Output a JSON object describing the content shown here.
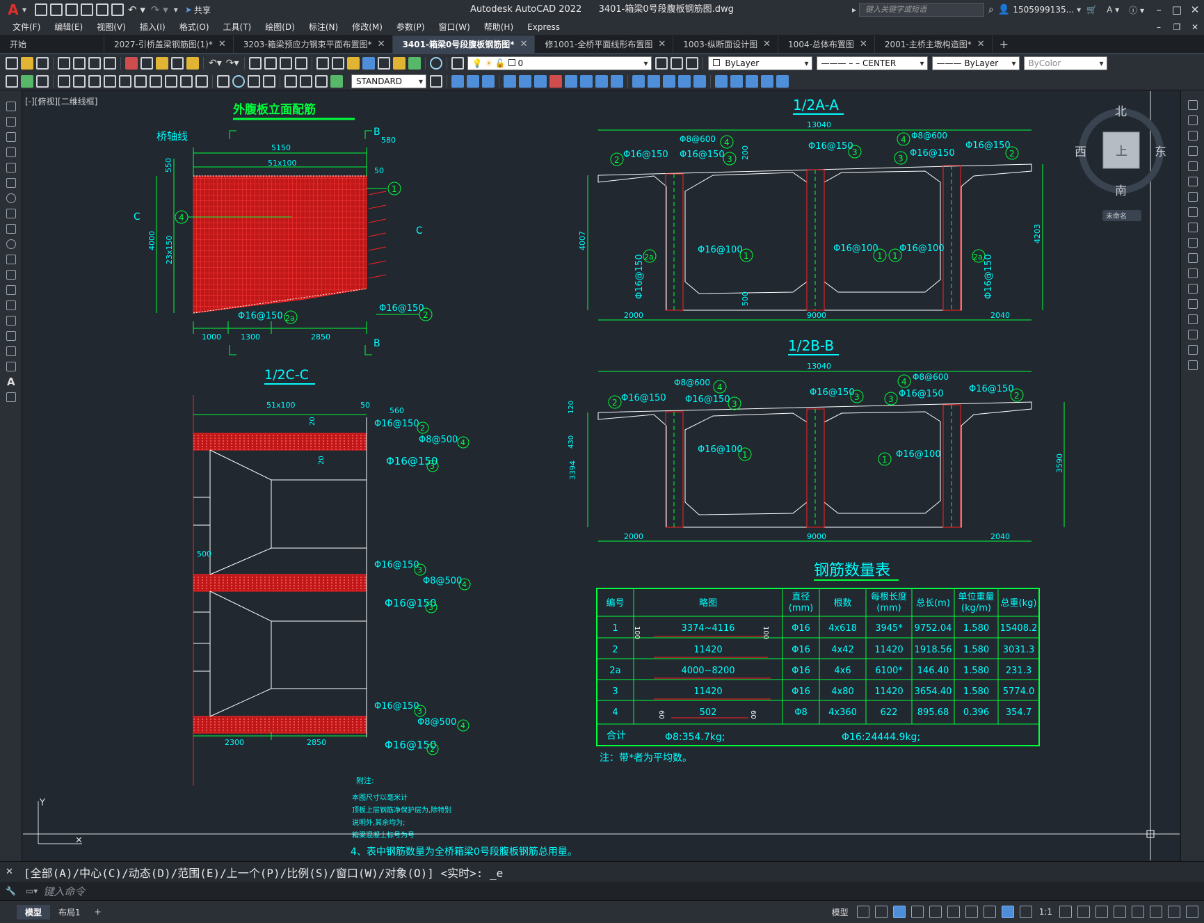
{
  "titlebar": {
    "app_title": "Autodesk AutoCAD 2022",
    "file_title": "3401-箱梁0号段腹板钢筋图.dwg",
    "share_label": "共享",
    "search_placeholder": "键入关键字或短语",
    "user": "1505999135..."
  },
  "menu": [
    "文件(F)",
    "编辑(E)",
    "视图(V)",
    "插入(I)",
    "格式(O)",
    "工具(T)",
    "绘图(D)",
    "标注(N)",
    "修改(M)",
    "参数(P)",
    "窗口(W)",
    "帮助(H)",
    "Express"
  ],
  "tabs": [
    {
      "label": "开始",
      "active": false,
      "closable": false
    },
    {
      "label": "2027-引桥盖梁钢筋图(1)*",
      "active": false,
      "closable": true
    },
    {
      "label": "3203-箱梁预应力钢束平面布置图*",
      "active": false,
      "closable": true
    },
    {
      "label": "3401-箱梁0号段腹板钢筋图*",
      "active": true,
      "closable": true
    },
    {
      "label": "修1001-全桥平面线形布置图",
      "active": false,
      "closable": true
    },
    {
      "label": "1003-纵断面设计图",
      "active": false,
      "closable": true
    },
    {
      "label": "1004-总体布置图",
      "active": false,
      "closable": true
    },
    {
      "label": "2001-主桥主墩构造图*",
      "active": false,
      "closable": true
    }
  ],
  "toolbar": {
    "layer": "0",
    "color": "ByLayer",
    "linetype": "CENTER",
    "lineweight": "ByLayer",
    "plotstyle": "ByColor",
    "textstyle": "STANDARD"
  },
  "viewport_label": "[-][俯视][二维线框]",
  "viewcube": {
    "n": "北",
    "s": "南",
    "e": "东",
    "w": "西",
    "face": "上",
    "ucs": "未命名"
  },
  "command": {
    "history": "[全部(A)/中心(C)/动态(D)/范围(E)/上一个(P)/比例(S)/窗口(W)/对象(O)] <实时>: _e",
    "placeholder": "键入命令"
  },
  "status": {
    "model_tab": "模型",
    "layout_tab": "布局1",
    "model_btn": "模型",
    "scale": "1:1"
  },
  "drawing": {
    "elev": {
      "title": "外腹板立面配筋",
      "axis_label": "桥轴线",
      "dim_top": "5150",
      "dim_sub": "51x100",
      "dim_550": "550",
      "dim_4000": "4000",
      "dim_23x150": "23x150",
      "dim_580": "580",
      "dim_50": "50",
      "dim_1000": "1000",
      "dim_1300": "1300",
      "dim_2850": "2850",
      "cut_b": "B",
      "cut_c": "C",
      "rebar_b1": "Φ16@150",
      "rebar_b2": "Φ16@150",
      "n1": "1",
      "n4": "4",
      "n2a": "2a",
      "n2": "2"
    },
    "cc": {
      "title": "1/2C-C",
      "dim_sub": "51x100",
      "dim_50": "50",
      "dim_560": "560",
      "dim_20a": "20",
      "dim_20b": "20",
      "dim_500": "500",
      "dim_2300": "2300",
      "dim_2850": "2850",
      "l1": "Φ16@150",
      "l2": "Φ8@500",
      "l3": "Φ16@150",
      "l4": "Φ16@150",
      "l5": "Φ8@500",
      "l6": "Φ16@150",
      "l7": "Φ16@150",
      "l8": "Φ8@500",
      "l9": "Φ16@150",
      "n2": "2",
      "n4": "4",
      "n3": "3"
    },
    "aa": {
      "title": "1/2A-A",
      "dim_total": "13040",
      "dim_l": "2000",
      "dim_m": "9000",
      "dim_r": "2040",
      "dim_h_l": "4007",
      "dim_h_r": "4203",
      "dim_500": "500",
      "dim_200": "200",
      "t_8600a": "Φ8@600",
      "t_8600b": "Φ8@600",
      "t_l150": "Φ16@150",
      "t_l150b": "Φ16@150",
      "t_m150": "Φ16@150",
      "t_r150": "Φ16@150",
      "t_r150b": "Φ16@150",
      "m100a": "Φ16@100",
      "m100b": "Φ16@100",
      "m100c": "Φ16@100",
      "v150l": "Φ16@150",
      "v150r": "Φ16@150",
      "n1": "1",
      "n2": "2",
      "n2a": "2a",
      "n3": "3",
      "n4": "4"
    },
    "bb": {
      "title": "1/2B-B",
      "dim_total": "13040",
      "dim_l": "2000",
      "dim_m": "9000",
      "dim_r": "2040",
      "dim_h_l": "3394",
      "dim_h_r": "3590",
      "dim_120": "120",
      "dim_430": "430",
      "t_8600a": "Φ8@600",
      "t_8600b": "Φ8@600",
      "t_l150": "Φ16@150",
      "t_l150b": "Φ16@150",
      "t_m150": "Φ16@150",
      "t_r150": "Φ16@150",
      "t_r150b": "Φ16@150",
      "m100a": "Φ16@100",
      "m100b": "Φ16@100",
      "n1": "1",
      "n2": "2",
      "n3": "3",
      "n4": "4"
    },
    "table": {
      "title": "钢筋数量表",
      "headers": [
        "编号",
        "略图",
        "直径\n(mm)",
        "根数",
        "每根长度\n(mm)",
        "总长(m)",
        "单位重量\n(kg/m)",
        "总重(kg)"
      ],
      "rows": [
        [
          "1",
          "3374~4116",
          "Φ16",
          "4x618",
          "3945*",
          "9752.04",
          "1.580",
          "15408.2"
        ],
        [
          "2",
          "11420",
          "Φ16",
          "4x42",
          "11420",
          "1918.56",
          "1.580",
          "3031.3"
        ],
        [
          "2a",
          "4000~8200",
          "Φ16",
          "4x6",
          "6100*",
          "146.40",
          "1.580",
          "231.3"
        ],
        [
          "3",
          "11420",
          "Φ16",
          "4x80",
          "11420",
          "3654.40",
          "1.580",
          "5774.0"
        ],
        [
          "4",
          "502",
          "Φ8",
          "4x360",
          "622",
          "895.68",
          "0.396",
          "354.7"
        ]
      ],
      "sketch_end_1": "100",
      "sketch_end_4": "60",
      "total_label": "合计",
      "total_a": "Φ8:354.7kg;",
      "total_b": "Φ16:24444.9kg;",
      "note": "注：带*者为平均数。"
    },
    "notes": {
      "head": "附注:",
      "l1": "本图尺寸以毫米计",
      "l2": "顶板上层钢筋净保护层为,除特别",
      "l3": "说明外,其余均为;",
      "l4": "箱梁混凝土标号为号",
      "l5": "4、表中钢筋数量为全桥箱梁0号段腹板钢筋总用量。"
    },
    "ucs": {
      "y": "Y"
    }
  }
}
